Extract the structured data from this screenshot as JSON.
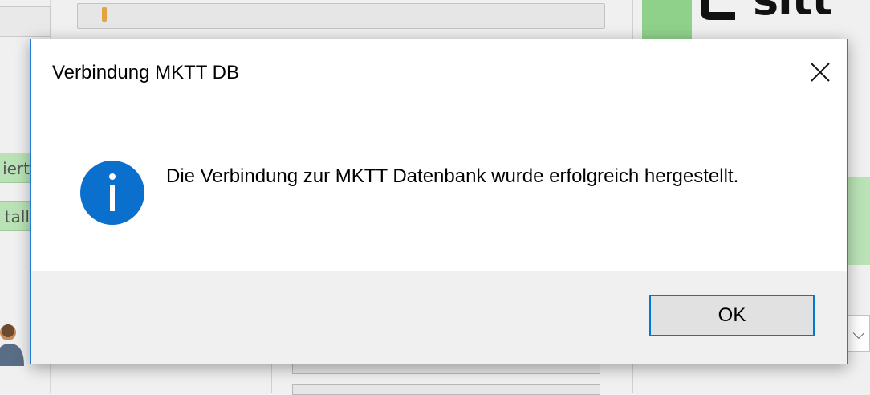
{
  "background": {
    "logo_fragment": "sitt",
    "chip_1_text": "iert",
    "chip_2_text": "tall",
    "dropdown_glyph": "⌵"
  },
  "dialog": {
    "title": "Verbindung MKTT DB",
    "close_icon": "close-icon",
    "info_icon": "info-icon",
    "message": "Die Verbindung zur MKTT Datenbank wurde erfolgreich hergestellt.",
    "ok_label": "OK"
  },
  "colors": {
    "accent_border": "#0078d7",
    "info_circle": "#0b6fce",
    "footer_bg": "#f0f0f0",
    "background_green": "#b9e3b6"
  }
}
